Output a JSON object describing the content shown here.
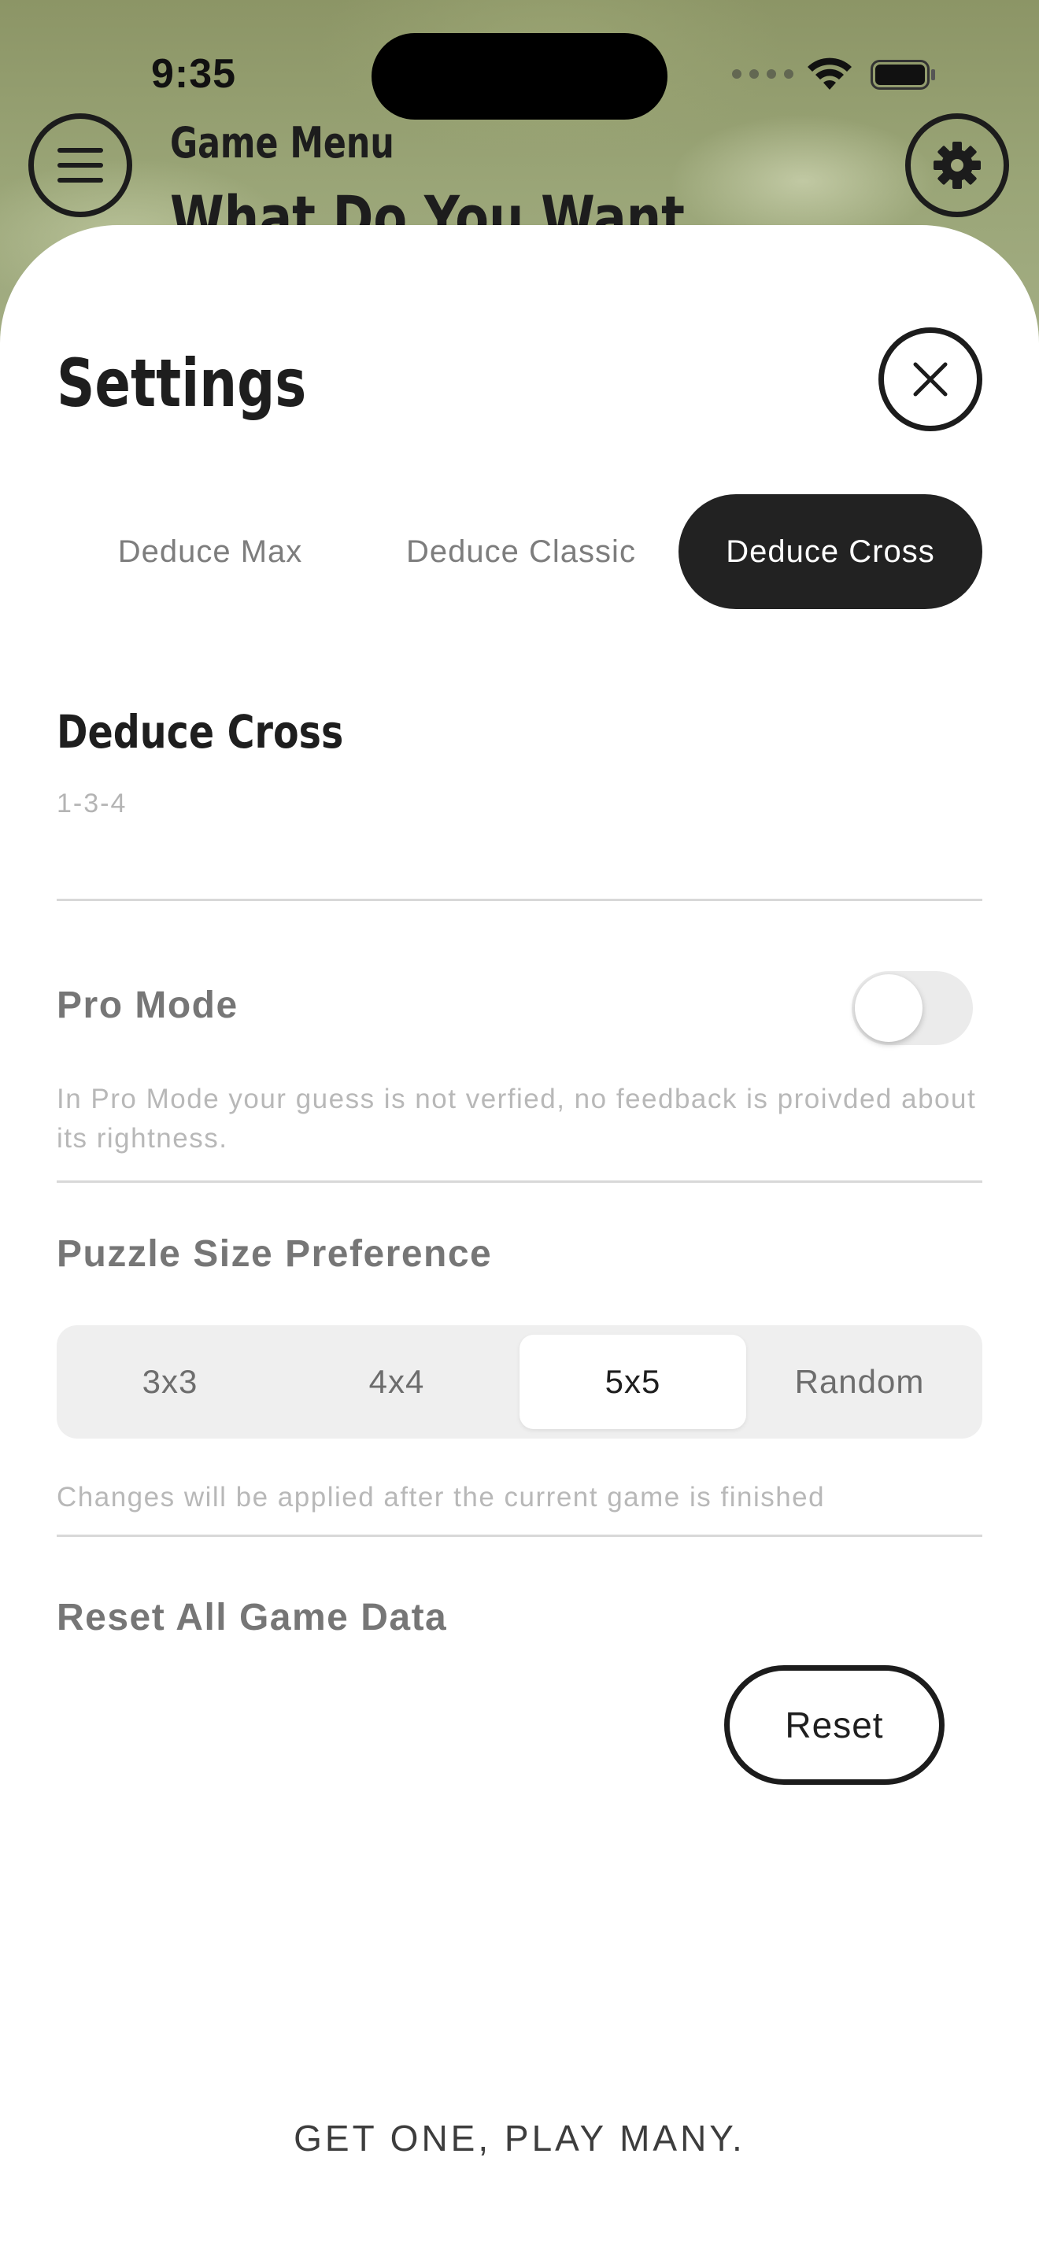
{
  "status_bar": {
    "time": "9:35"
  },
  "background": {
    "title": "Game Menu",
    "heading": "What Do You Want"
  },
  "settings": {
    "title": "Settings",
    "tabs": [
      {
        "label": "Deduce Max",
        "selected": false
      },
      {
        "label": "Deduce Classic",
        "selected": false
      },
      {
        "label": "Deduce Cross",
        "selected": true
      }
    ],
    "mode": {
      "title": "Deduce Cross",
      "code": "1-3-4"
    },
    "pro_mode": {
      "label": "Pro Mode",
      "enabled": false,
      "hint": "In Pro Mode your guess is not verfied, no feedback is proivded about its rightness."
    },
    "puzzle_size": {
      "label": "Puzzle Size Preference",
      "options": [
        "3x3",
        "4x4",
        "5x5",
        "Random"
      ],
      "selected": "5x5",
      "hint": "Changes will be applied after the current game is finished"
    },
    "reset": {
      "label": "Reset All Game Data",
      "button_label": "Reset"
    },
    "footer": "GET ONE, PLAY MANY."
  },
  "colors": {
    "accent_dark": "#222222",
    "background_green": "#9aa577",
    "muted_text": "#767676"
  }
}
